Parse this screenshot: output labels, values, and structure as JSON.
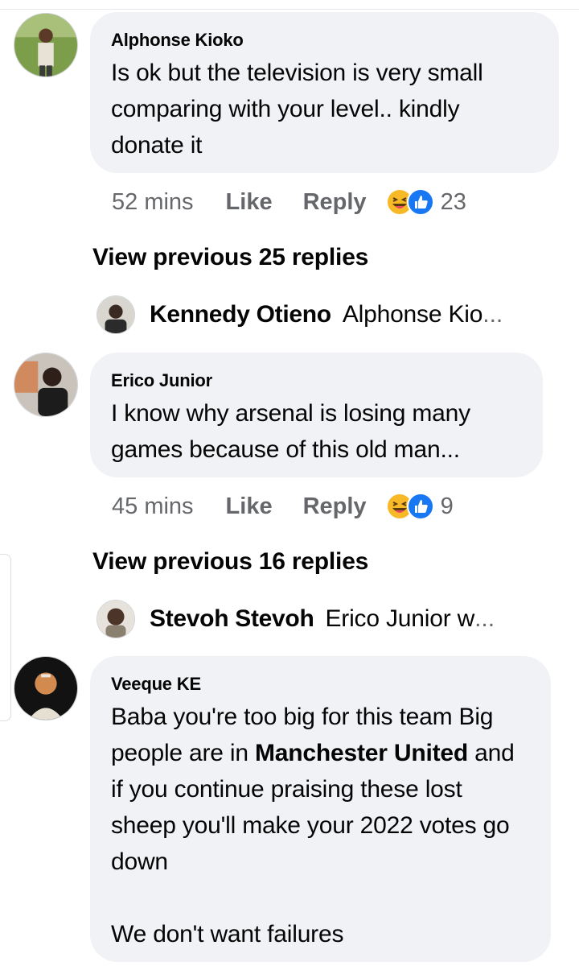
{
  "comments": [
    {
      "author": "Alphonse Kioko",
      "text": "Is ok but the television is very small comparing with your level.. kindly donate it",
      "time": "52 mins",
      "like_label": "Like",
      "reply_label": "Reply",
      "reaction_count": "23",
      "reactions": [
        "haha-icon",
        "like-icon"
      ]
    },
    {
      "author": "Erico Junior",
      "text": "I know why arsenal is losing many games because of this old man...",
      "time": "45 mins",
      "like_label": "Like",
      "reply_label": "Reply",
      "reaction_count": "9",
      "reactions": [
        "haha-icon",
        "like-icon"
      ]
    },
    {
      "author": "Veeque KE",
      "text_part1": "Baba you're too big for this team Big people are in ",
      "text_bold": "Manchester United",
      "text_part2": " and if you continue praising these lost sheep you'll make your 2022 votes go down\n\nWe don't want failures"
    }
  ],
  "view_previous": [
    "View previous 25 replies",
    "View previous 16 replies"
  ],
  "reply_previews": [
    {
      "name": "Kennedy Otieno",
      "text": "Alphonse Kio",
      "ellipsis": "..."
    },
    {
      "name": "Stevoh Stevoh",
      "text": "Erico Junior w",
      "ellipsis": "..."
    }
  ],
  "colors": {
    "bubble": "#f0f2f5",
    "meta_text": "#65676b",
    "text": "#050505",
    "like_blue": "#1877f2",
    "haha_yellow": "#f7b928"
  }
}
